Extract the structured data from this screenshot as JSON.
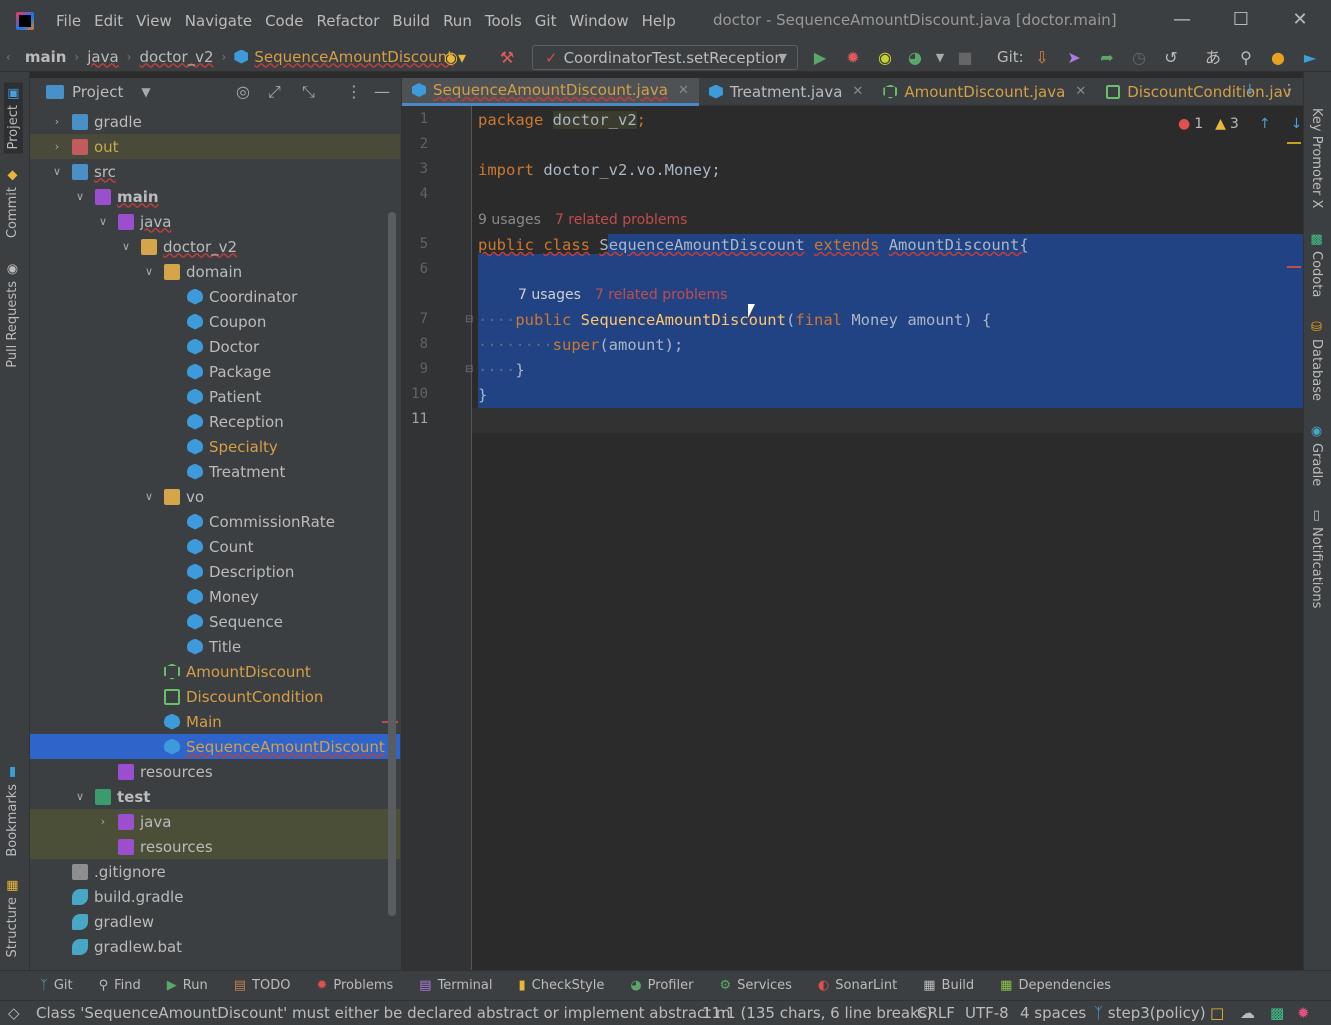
{
  "menu": {
    "items": [
      "File",
      "Edit",
      "View",
      "Navigate",
      "Code",
      "Refactor",
      "Build",
      "Run",
      "Tools",
      "Git",
      "Window",
      "Help"
    ],
    "window_title": "doctor - SequenceAmountDiscount.java [doctor.main]"
  },
  "breadcrumb": {
    "items": [
      "main",
      "java",
      "doctor_v2",
      "SequenceAmountDiscount"
    ]
  },
  "toolbar": {
    "run_config": "CoordinatorTest.setReception",
    "git_label": "Git:"
  },
  "project_panel": {
    "title": "Project",
    "tree": [
      {
        "label": "gradle",
        "indent": 1,
        "arrow": "right",
        "icon": "folder-blue"
      },
      {
        "label": "out",
        "indent": 1,
        "arrow": "right",
        "icon": "folder-red"
      },
      {
        "label": "src",
        "indent": 1,
        "arrow": "down",
        "icon": "folder-blue"
      },
      {
        "label": "main",
        "indent": 2,
        "arrow": "down",
        "icon": "folder-purple"
      },
      {
        "label": "java",
        "indent": 3,
        "arrow": "down",
        "icon": "folder-purple"
      },
      {
        "label": "doctor_v2",
        "indent": 4,
        "arrow": "down",
        "icon": "folder"
      },
      {
        "label": "domain",
        "indent": 5,
        "arrow": "down",
        "icon": "folder"
      },
      {
        "label": "Coordinator",
        "indent": 6,
        "arrow": "",
        "icon": "class"
      },
      {
        "label": "Coupon",
        "indent": 6,
        "arrow": "",
        "icon": "class"
      },
      {
        "label": "Doctor",
        "indent": 6,
        "arrow": "",
        "icon": "class"
      },
      {
        "label": "Package",
        "indent": 6,
        "arrow": "",
        "icon": "class"
      },
      {
        "label": "Patient",
        "indent": 6,
        "arrow": "",
        "icon": "class"
      },
      {
        "label": "Reception",
        "indent": 6,
        "arrow": "",
        "icon": "class"
      },
      {
        "label": "Specialty",
        "indent": 6,
        "arrow": "",
        "icon": "class"
      },
      {
        "label": "Treatment",
        "indent": 6,
        "arrow": "",
        "icon": "class"
      },
      {
        "label": "vo",
        "indent": 5,
        "arrow": "down",
        "icon": "folder"
      },
      {
        "label": "CommissionRate",
        "indent": 6,
        "arrow": "",
        "icon": "class"
      },
      {
        "label": "Count",
        "indent": 6,
        "arrow": "",
        "icon": "class"
      },
      {
        "label": "Description",
        "indent": 6,
        "arrow": "",
        "icon": "class"
      },
      {
        "label": "Money",
        "indent": 6,
        "arrow": "",
        "icon": "class"
      },
      {
        "label": "Sequence",
        "indent": 6,
        "arrow": "",
        "icon": "class"
      },
      {
        "label": "Title",
        "indent": 6,
        "arrow": "",
        "icon": "class"
      },
      {
        "label": "AmountDiscount",
        "indent": 5,
        "arrow": "",
        "icon": "abstract"
      },
      {
        "label": "DiscountCondition",
        "indent": 5,
        "arrow": "",
        "icon": "interface"
      },
      {
        "label": "Main",
        "indent": 5,
        "arrow": "",
        "icon": "class"
      },
      {
        "label": "SequenceAmountDiscount",
        "indent": 5,
        "arrow": "",
        "icon": "class"
      },
      {
        "label": "resources",
        "indent": 3,
        "arrow": "",
        "icon": "folder-purple"
      },
      {
        "label": "test",
        "indent": 2,
        "arrow": "down",
        "icon": "folder-green"
      },
      {
        "label": "java",
        "indent": 3,
        "arrow": "right",
        "icon": "folder-purple"
      },
      {
        "label": "resources",
        "indent": 3,
        "arrow": "",
        "icon": "folder-purple"
      },
      {
        "label": ".gitignore",
        "indent": 1,
        "arrow": "",
        "icon": "file"
      },
      {
        "label": "build.gradle",
        "indent": 1,
        "arrow": "",
        "icon": "gradle"
      },
      {
        "label": "gradlew",
        "indent": 1,
        "arrow": "",
        "icon": "gradle"
      },
      {
        "label": "gradlew.bat",
        "indent": 1,
        "arrow": "",
        "icon": "gradle"
      }
    ]
  },
  "editor_tabs": [
    {
      "label": "SequenceAmountDiscount.java",
      "active": true
    },
    {
      "label": "Treatment.java",
      "active": false
    },
    {
      "label": "AmountDiscount.java",
      "active": false
    },
    {
      "label": "DiscountCondition.jav",
      "active": false
    }
  ],
  "editor": {
    "line_numbers": [
      "1",
      "2",
      "3",
      "4",
      "5",
      "6",
      "7",
      "8",
      "9",
      "10",
      "11"
    ],
    "code": {
      "l1_kw": "package",
      "l1_pkg": "doctor_v2",
      "l3_kw": "import",
      "l3_rest": "doctor_v2.vo.Money;",
      "hint1_usages": "9 usages",
      "hint1_problems": "7 related problems",
      "l5_public": "public",
      "l5_class": "class",
      "l5_name": "SequenceAmountDiscount",
      "l5_extends": "extends",
      "l5_super": "AmountDiscount{",
      "hint2_usages": "7 usages",
      "hint2_problems": "7 related problems",
      "l7_public": "public",
      "l7_name": "SequenceAmountDiscount",
      "l7_final": "final",
      "l7_rest": "Money amount) {",
      "l8_super": "super",
      "l8_rest": "(amount);",
      "l9": "}",
      "l10": "}"
    },
    "errors": "1",
    "warnings": "3"
  },
  "right_stripe": [
    "Key Promoter X",
    "Codota",
    "Database",
    "Gradle",
    "Notifications"
  ],
  "left_stripe": [
    "Project",
    "Commit",
    "Pull Requests",
    "Bookmarks",
    "Structure"
  ],
  "bottom_tools": [
    "Git",
    "Find",
    "Run",
    "TODO",
    "Problems",
    "Terminal",
    "CheckStyle",
    "Profiler",
    "Services",
    "SonarLint",
    "Build",
    "Dependencies"
  ],
  "status": {
    "message": "Class 'SequenceAmountDiscount' must either be declared abstract or implement abstract m",
    "position": "11:1 (135 chars, 6 line breaks)",
    "line_sep": "CRLF",
    "encoding": "UTF-8",
    "indent": "4 spaces",
    "branch": "step3(policy)"
  }
}
